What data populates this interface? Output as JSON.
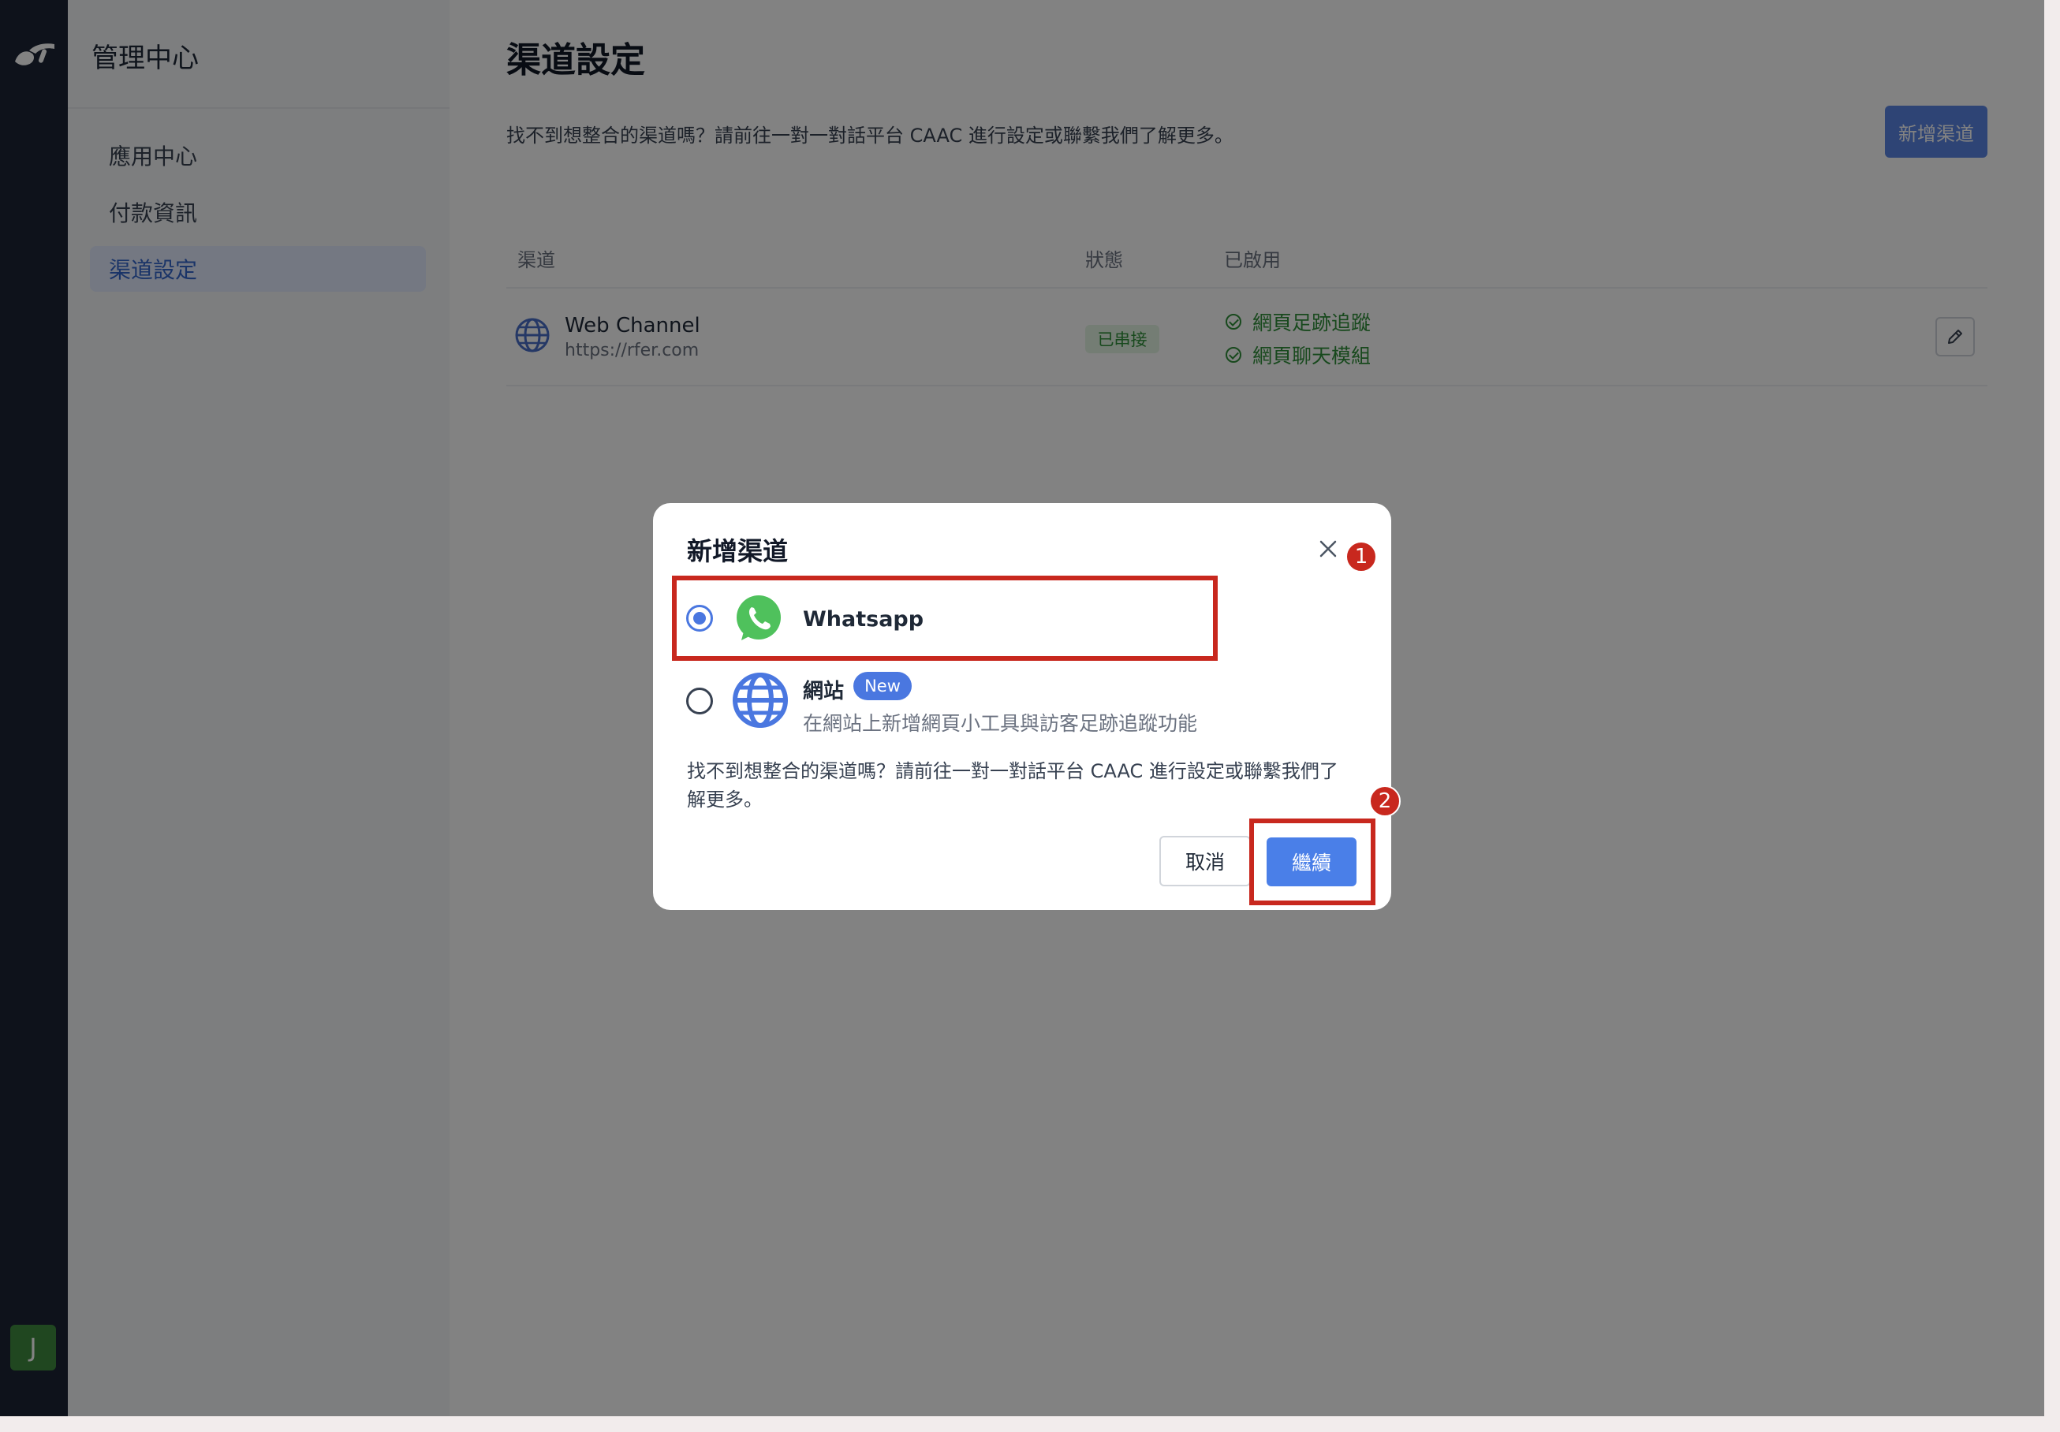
{
  "sidebar": {
    "title": "管理中心",
    "items": [
      {
        "label": "應用中心"
      },
      {
        "label": "付款資訊"
      },
      {
        "label": "渠道設定"
      }
    ],
    "avatar_initial": "J"
  },
  "page": {
    "title": "渠道設定",
    "subtitle": "找不到想整合的渠道嗎？請前往一對一對話平台 CAAC 進行設定或聯繫我們了解更多。",
    "add_button": "新增渠道"
  },
  "table": {
    "columns": [
      "渠道",
      "狀態",
      "已啟用"
    ],
    "rows": [
      {
        "name": "Web Channel",
        "url": "https://rfer.com",
        "status": "已串接",
        "features": [
          "網頁足跡追蹤",
          "網頁聊天模組"
        ]
      }
    ]
  },
  "modal": {
    "title": "新增渠道",
    "options": [
      {
        "label": "Whatsapp",
        "selected": true
      },
      {
        "label": "網站",
        "badge": "New",
        "description": "在網站上新增網頁小工具與訪客足跡追蹤功能",
        "selected": false
      }
    ],
    "note": "找不到想整合的渠道嗎？請前往一對一對話平台 CAAC 進行設定或聯繫我們了解更多。",
    "cancel_label": "取消",
    "continue_label": "繼續"
  },
  "annotations": {
    "step1": "1",
    "step2": "2",
    "highlight_color": "#c8281e"
  },
  "colors": {
    "accent": "#4a77e0",
    "success": "#2f8f3a",
    "rail": "#1c2536",
    "whatsapp": "#4fc15c"
  },
  "icons": [
    "brand-logo-icon",
    "globe-icon",
    "check-circle-icon",
    "pencil-icon",
    "close-icon",
    "whatsapp-icon"
  ]
}
